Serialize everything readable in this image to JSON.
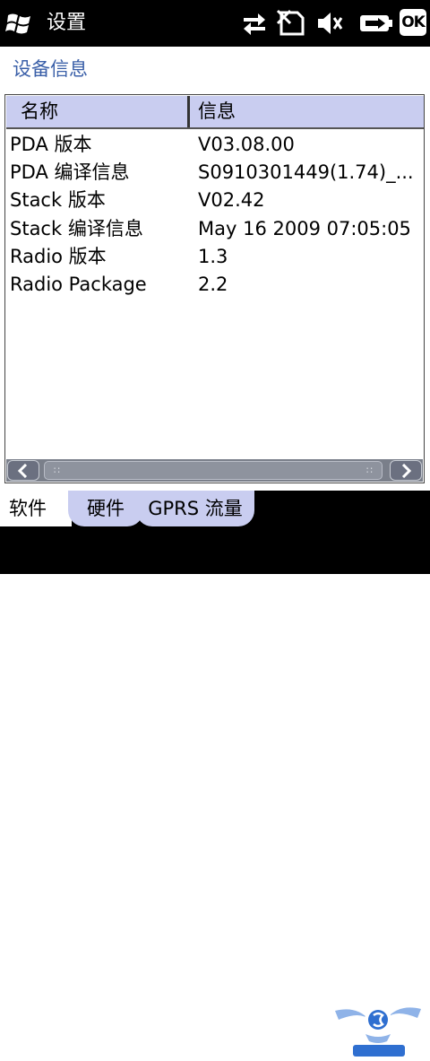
{
  "titlebar": {
    "title": "设置",
    "ok_label": "OK",
    "icons": [
      "windows-start-icon",
      "data-connection-icon",
      "no-sim-icon",
      "volume-muted-icon",
      "battery-charging-icon"
    ]
  },
  "page": {
    "title": "设备信息"
  },
  "list": {
    "columns": [
      "名称",
      "信息"
    ],
    "rows": [
      [
        "PDA 版本",
        "V03.08.00"
      ],
      [
        "PDA 编译信息",
        "S0910301449(1.74)_..."
      ],
      [
        "Stack 版本",
        "V02.42"
      ],
      [
        "Stack 编译信息",
        "May 16 2009 07:05:05"
      ],
      [
        "Radio 版本",
        "1.3"
      ],
      [
        "Radio Package",
        "2.2"
      ]
    ]
  },
  "tabs": [
    {
      "label": "软件",
      "active": true
    },
    {
      "label": "硬件",
      "active": false
    },
    {
      "label": "GPRS 流量",
      "active": false
    }
  ],
  "colors": {
    "header_bg": "#c9cdf0",
    "title_blue": "#3a5fa8",
    "bar_bg": "#000000"
  }
}
